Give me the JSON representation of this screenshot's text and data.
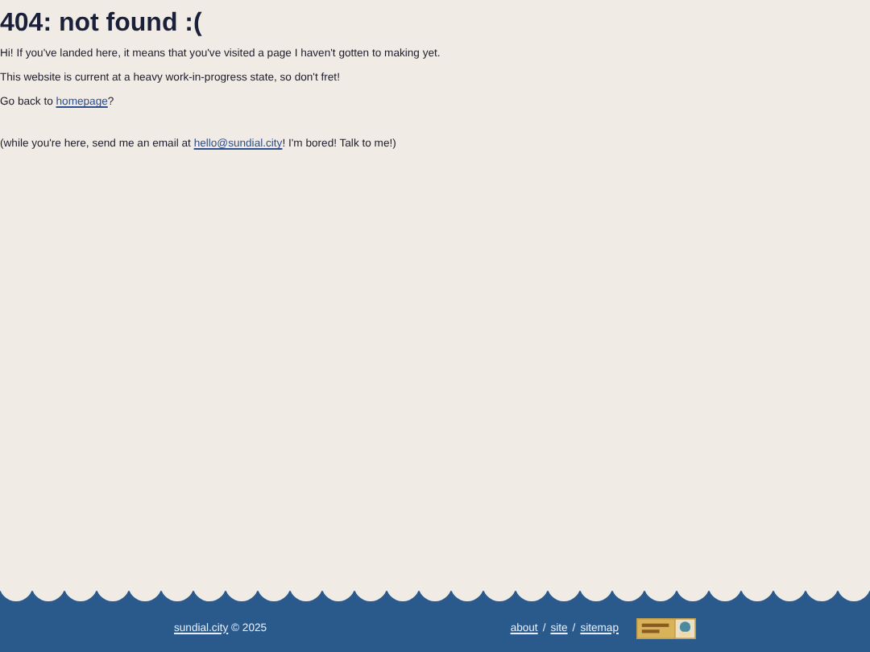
{
  "heading": "404: not found :(",
  "paragraphs": [
    {
      "before": "Hi! If you've landed here, it means that you've visited a page I haven't gotten to making yet."
    },
    {
      "before": "This website is current at a heavy work-in-progress state, so don't fret!"
    },
    {
      "before": "Go back to ",
      "link": "homepage",
      "after": "?"
    }
  ],
  "aside": {
    "before": "(while you're here, send me an email at ",
    "link": "hello@sundial.city",
    "after": "! I'm bored! Talk to me!)"
  },
  "footer": {
    "site_link": "sundial.city",
    "copyright": "© 2025",
    "nav_links": [
      "about",
      "site",
      "sitemap"
    ],
    "separator": "/"
  }
}
